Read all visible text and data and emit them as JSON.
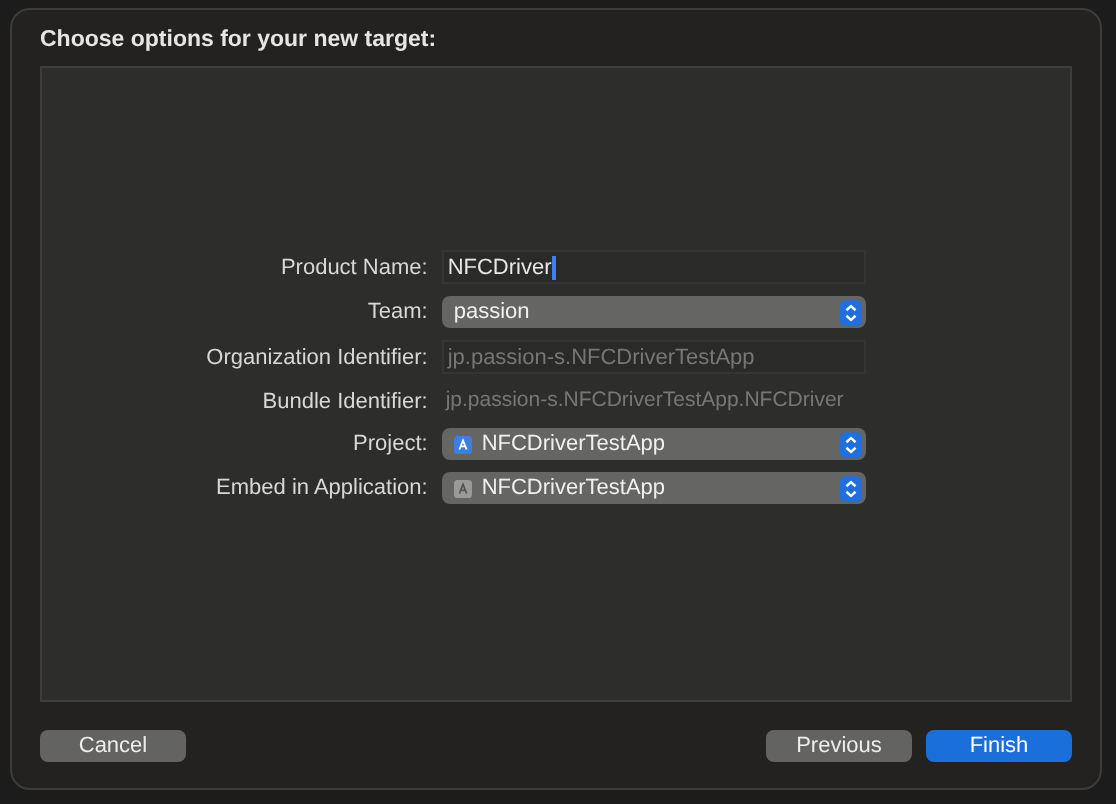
{
  "sheet": {
    "title": "Choose options for your new target:"
  },
  "fields": [
    {
      "label": "Product Name:",
      "kind": "text",
      "value": "NFCDriver",
      "focused": true
    },
    {
      "label": "Team:",
      "kind": "popup",
      "value": "passion"
    },
    {
      "label": "Organization Identifier:",
      "kind": "text",
      "value": "jp.passion-s.NFCDriverTestApp",
      "disabled": true
    },
    {
      "label": "Bundle Identifier:",
      "kind": "static",
      "value": "jp.passion-s.NFCDriverTestApp.NFCDriver"
    },
    {
      "label": "Project:",
      "kind": "popup",
      "value": "NFCDriverTestApp"
    },
    {
      "label": "Embed in Application:",
      "kind": "popup",
      "value": "NFCDriverTestApp"
    }
  ],
  "buttons": [
    {
      "label": "Cancel",
      "kind": "normal"
    },
    {
      "label": "Previous",
      "kind": "normal"
    },
    {
      "label": "Finish",
      "kind": "default"
    }
  ]
}
